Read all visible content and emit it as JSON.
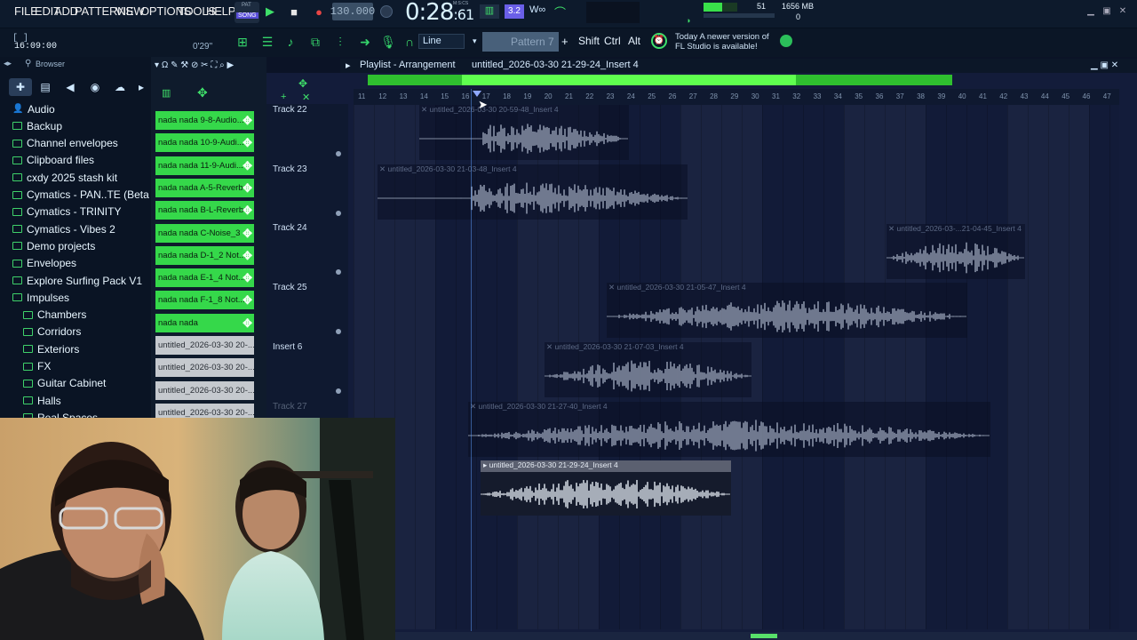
{
  "menu": [
    "FILE",
    "EDIT",
    "ADD",
    "PATTERNS",
    "VIEW",
    "OPTIONS",
    "TOOLS",
    "HELP"
  ],
  "transport": {
    "mode_top": "PAT",
    "mode_bottom": "SONG",
    "tempo": "130.000",
    "time": "0:28",
    "time_frac": "61",
    "time_unit": "M:S:CS",
    "metronome_label": "3.2"
  },
  "cpu": {
    "voices": "51",
    "memory": "1656 MB",
    "poly": "0",
    "cpu_fill": 0.55
  },
  "bar2": {
    "hint": "[ ]",
    "clock": "16:09:00",
    "percent": "0'29\"",
    "snap": "Line",
    "pattern": "Pattern 7",
    "shift": "Shift",
    "ctrl": "Ctrl",
    "alt": "Alt",
    "news_line1": "Today  A newer version of",
    "news_line2": "FL Studio is available!"
  },
  "browser": {
    "title": "Browser",
    "folders": [
      "Audio",
      "Backup",
      "Channel envelopes",
      "Clipboard files",
      "cxdy 2025 stash kit",
      "Cymatics - PAN..TE (Beta Pack)",
      "Cymatics - TRINITY",
      "Cymatics - Vibes 2",
      "Demo projects",
      "Envelopes",
      "Explore Surfing Pack V1",
      "Impulses"
    ],
    "subfolders": [
      "Chambers",
      "Corridors",
      "Exteriors",
      "FX",
      "Guitar Cabinet",
      "Halls",
      "Real Spaces"
    ]
  },
  "channels": [
    {
      "label": "nada nada 9-8-Audio...",
      "color": "green"
    },
    {
      "label": "nada nada 10-9-Audi...",
      "color": "green"
    },
    {
      "label": "nada nada 11-9-Audi...",
      "color": "green"
    },
    {
      "label": "nada nada A-5-Reverb",
      "color": "green"
    },
    {
      "label": "nada nada B-L-Reverb",
      "color": "green"
    },
    {
      "label": "nada nada C-Noise_3",
      "color": "green"
    },
    {
      "label": "nada nada D-1_2 Not...",
      "color": "green"
    },
    {
      "label": "nada nada E-1_4 Not...",
      "color": "green"
    },
    {
      "label": "nada nada F-1_8 Not...",
      "color": "green"
    },
    {
      "label": "nada nada",
      "color": "green"
    },
    {
      "label": "untitled_2026-03-30 20-...",
      "color": "gray"
    },
    {
      "label": "untitled_2026-03-30 20-...",
      "color": "gray"
    },
    {
      "label": "untitled_2026-03-30 20-...",
      "color": "gray"
    },
    {
      "label": "untitled_2026-03-30 20-...",
      "color": "gray"
    }
  ],
  "playlist": {
    "title": "Playlist - Arrangement",
    "project": "untitled_2026-03-30 21-29-24_Insert 4",
    "tracks": [
      "Track 22",
      "Track 23",
      "Track 24",
      "Track 25",
      "Insert 6",
      "Track 27"
    ],
    "ruler": [
      "11",
      "12",
      "13",
      "14",
      "15",
      "16",
      "17",
      "18",
      "19",
      "20",
      "21",
      "22",
      "23",
      "24",
      "25",
      "26",
      "27",
      "28",
      "29",
      "30",
      "31",
      "32",
      "33",
      "34",
      "35",
      "36",
      "37",
      "38",
      "39",
      "40",
      "41",
      "42",
      "43",
      "44",
      "45",
      "46",
      "47"
    ],
    "clips": [
      {
        "label": "untitled_2026-03-30 20-59-48_Insert 4"
      },
      {
        "label": "untitled_2026-03-30 21-03-48_Insert 4"
      },
      {
        "label": "untitled_2026-03-...21-04-45_Insert 4"
      },
      {
        "label": "untitled_2026-03-30 21-05-47_Insert 4"
      },
      {
        "label": "untitled_2026-03-30 21-07-03_Insert 4"
      },
      {
        "label": "untitled_2026-03-30 21-27-40_Insert 4"
      },
      {
        "label": "untitled_2026-03-30 21-29-24_Insert 4"
      }
    ]
  },
  "colors": {
    "accent": "#35d84a",
    "bg": "#131c3a",
    "panel": "#0a1424"
  }
}
